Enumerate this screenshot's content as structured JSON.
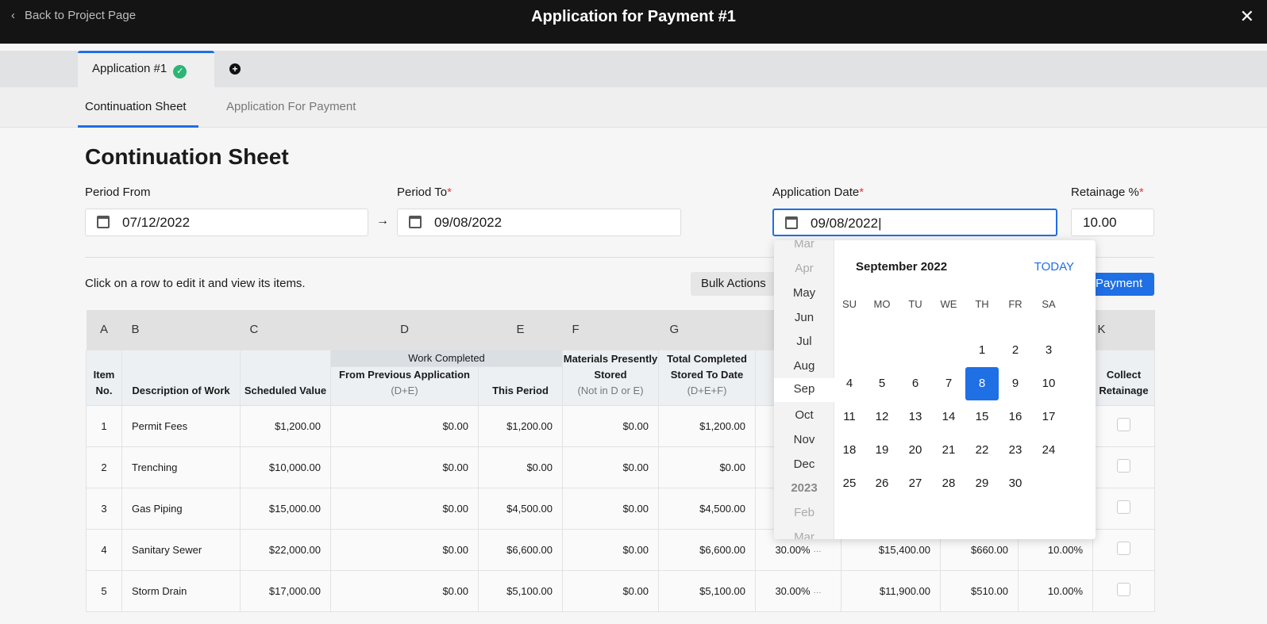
{
  "header": {
    "back": "Back to Project Page",
    "title": "Application for Payment #1",
    "close": "✕"
  },
  "tabs": {
    "app_tab": "Application #1",
    "add": "+"
  },
  "subtabs": [
    "Continuation Sheet",
    "Application For Payment"
  ],
  "page_title": "Continuation Sheet",
  "form": {
    "period_from_label": "Period From",
    "period_from": "07/12/2022",
    "period_to_label": "Period To",
    "period_to": "09/08/2022",
    "app_date_label": "Application Date",
    "app_date": "09/08/2022",
    "retainage_label": "Retainage %",
    "retainage": "10.00",
    "req": "*"
  },
  "hint": "Click on a row to edit it and view its items.",
  "bulk": "Bulk Actions",
  "pay": "Payment",
  "table": {
    "letters": [
      "A",
      "B",
      "C",
      "D",
      "E",
      "F",
      "G",
      "K"
    ],
    "headers": {
      "item": "Item No.",
      "desc": "Description of Work",
      "sched": "Scheduled Value",
      "work_completed": "Work Completed",
      "prev": "From Previous Application",
      "prev_sub": "(D+E)",
      "this": "This Period",
      "mat": "Materials Presently Stored",
      "mat_sub": "(Not in D or E)",
      "total": "Total Completed Stored To Date",
      "total_sub": "(D+E+F)",
      "collect": "Collect Retainage"
    },
    "rows": [
      {
        "no": "1",
        "desc": "Permit Fees",
        "sched": "$1,200.00",
        "prev": "$0.00",
        "this": "$1,200.00",
        "mat": "$0.00",
        "total": "$1,200.00",
        "pct": "",
        "bal": "",
        "ret": "",
        "retpct": ""
      },
      {
        "no": "2",
        "desc": "Trenching",
        "sched": "$10,000.00",
        "prev": "$0.00",
        "this": "$0.00",
        "mat": "$0.00",
        "total": "$0.00",
        "pct": "",
        "bal": "",
        "ret": "",
        "retpct": ""
      },
      {
        "no": "3",
        "desc": "Gas Piping",
        "sched": "$15,000.00",
        "prev": "$0.00",
        "this": "$4,500.00",
        "mat": "$0.00",
        "total": "$4,500.00",
        "pct": "",
        "bal": "",
        "ret": "",
        "retpct": ""
      },
      {
        "no": "4",
        "desc": "Sanitary Sewer",
        "sched": "$22,000.00",
        "prev": "$0.00",
        "this": "$6,600.00",
        "mat": "$0.00",
        "total": "$6,600.00",
        "pct": "30.00%",
        "bal": "$15,400.00",
        "ret": "$660.00",
        "retpct": "10.00%"
      },
      {
        "no": "5",
        "desc": "Storm Drain",
        "sched": "$17,000.00",
        "prev": "$0.00",
        "this": "$5,100.00",
        "mat": "$0.00",
        "total": "$5,100.00",
        "pct": "30.00%",
        "bal": "$11,900.00",
        "ret": "$510.00",
        "retpct": "10.00%"
      }
    ]
  },
  "datepicker": {
    "month_title": "September 2022",
    "today": "TODAY",
    "selected_day": 8,
    "months": [
      "Mar",
      "Apr",
      "May",
      "Jun",
      "Jul",
      "Aug",
      "Sep",
      "Oct",
      "Nov",
      "Dec",
      "2023",
      "Feb",
      "Mar"
    ],
    "dow": [
      "SU",
      "MO",
      "TU",
      "WE",
      "TH",
      "FR",
      "SA"
    ]
  }
}
